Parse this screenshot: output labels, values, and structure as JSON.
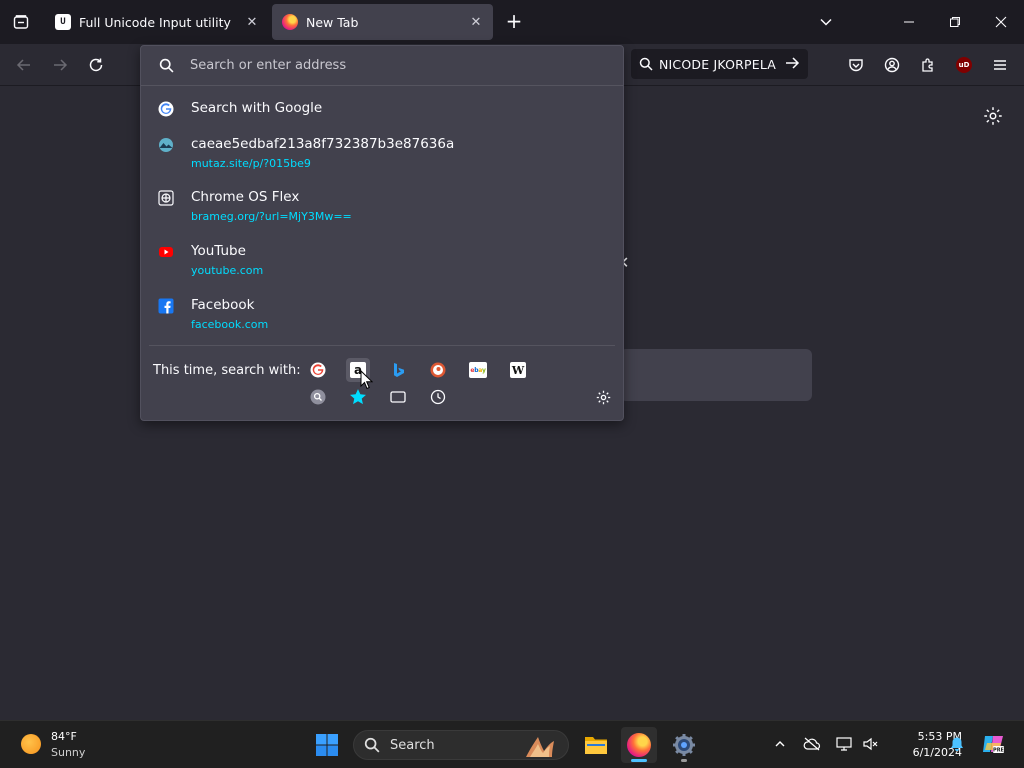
{
  "colors": {
    "tabstrip": "#1c1b22",
    "toolbar": "#2b2a33",
    "popup": "#42414d",
    "url_link": "#00ddff",
    "taskbar": "#202020"
  },
  "tabs": [
    {
      "title": "Full Unicode Input utility",
      "favicon": "unicode-u-icon",
      "selected": false
    },
    {
      "title": "New Tab",
      "favicon": "firefox-icon",
      "selected": true
    }
  ],
  "toolbar": {
    "search_pill_text": "NICODE JKORPELA"
  },
  "urlbar": {
    "placeholder": "Search or enter address",
    "results": [
      {
        "title": "Search with Google",
        "url": "",
        "icon": "google-icon"
      },
      {
        "title": "caeae5edbaf213a8f732387b3e87636a",
        "url": "mutaz.site/p/?015be9",
        "icon": "site-icon"
      },
      {
        "title": "Chrome OS Flex",
        "url": "brameg.org/?url=MjY3Mw==",
        "icon": "globe-icon"
      },
      {
        "title": "YouTube",
        "url": "youtube.com",
        "icon": "youtube-icon"
      },
      {
        "title": "Facebook",
        "url": "facebook.com",
        "icon": "facebook-icon"
      }
    ],
    "search_with_label": "This time, search with:",
    "engines": [
      "google",
      "amazon",
      "bing",
      "duckduckgo",
      "ebay",
      "wikipedia"
    ],
    "modes": [
      "search",
      "bookmarks",
      "tabs",
      "history"
    ]
  },
  "taskbar": {
    "weather_temp": "84°F",
    "weather_condition": "Sunny",
    "search_placeholder": "Search",
    "clock_time": "5:53 PM",
    "clock_date": "6/1/2024"
  }
}
